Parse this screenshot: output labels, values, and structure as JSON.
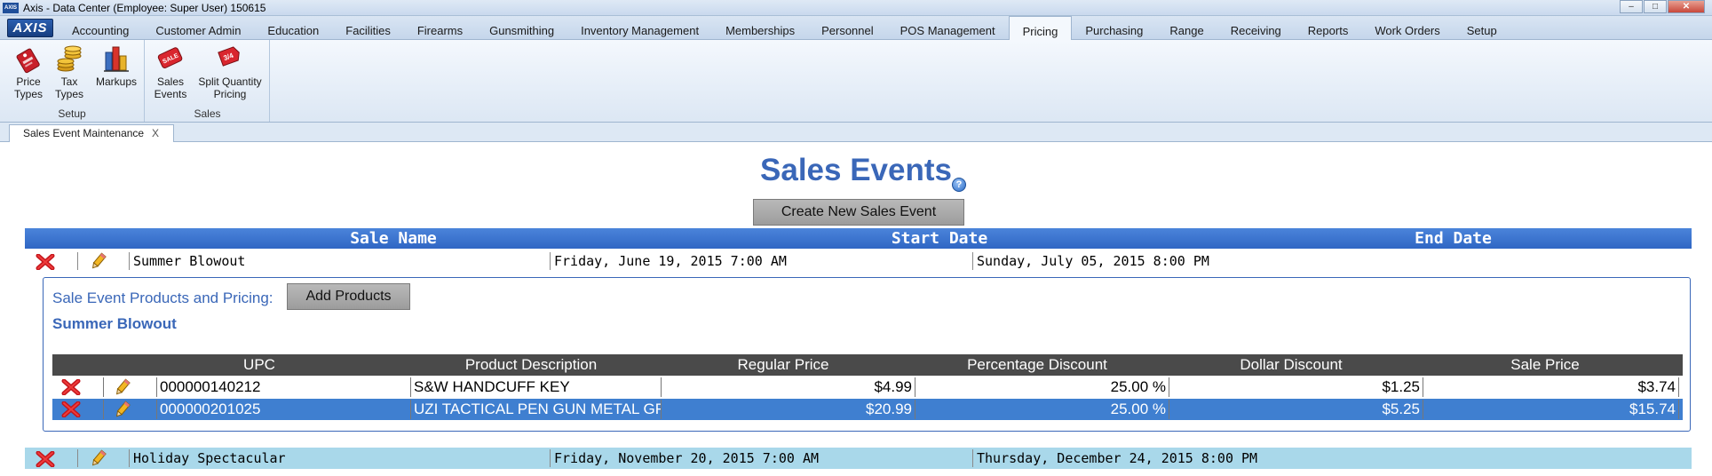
{
  "window": {
    "app_icon_text": "AXIS",
    "title": "Axis - Data Center  (Employee: Super User) 150615",
    "minimize": "–",
    "maximize": "□",
    "close": "✕"
  },
  "menu": {
    "logo": "AXIS",
    "tabs": [
      "Accounting",
      "Customer Admin",
      "Education",
      "Facilities",
      "Firearms",
      "Gunsmithing",
      "Inventory Management",
      "Memberships",
      "Personnel",
      "POS Management",
      "Pricing",
      "Purchasing",
      "Range",
      "Receiving",
      "Reports",
      "Work Orders",
      "Setup"
    ],
    "active_tab": "Pricing"
  },
  "ribbon": {
    "groups": [
      {
        "label": "Setup",
        "buttons": [
          {
            "label": "Price\nTypes",
            "icon": "price-tag-icon"
          },
          {
            "label": "Tax\nTypes",
            "icon": "coins-icon"
          },
          {
            "label": "Markups",
            "icon": "bar-chart-icon"
          }
        ]
      },
      {
        "label": "Sales",
        "buttons": [
          {
            "label": "Sales\nEvents",
            "icon": "sale-tag-icon"
          },
          {
            "label": "Split Quantity\nPricing",
            "icon": "split-price-tag-icon"
          }
        ]
      }
    ]
  },
  "doc_tab": {
    "label": "Sales Event Maintenance",
    "close": "X"
  },
  "main": {
    "title": "Sales Events",
    "help": "?",
    "create_button": "Create New Sales Event",
    "columns": [
      "Sale Name",
      "Start Date",
      "End Date"
    ],
    "events": [
      {
        "name": "Summer Blowout",
        "start": "Friday, June 19, 2015 7:00 AM",
        "end": "Sunday, July 05, 2015 8:00 PM"
      },
      {
        "name": "Holiday Spectacular",
        "start": "Friday, November 20, 2015 7:00 AM",
        "end": "Thursday, December 24, 2015 8:00 PM"
      }
    ]
  },
  "products_panel": {
    "label": "Sale Event Products and Pricing:",
    "add_button": "Add Products",
    "event_name": "Summer Blowout",
    "columns": [
      "UPC",
      "Product Description",
      "Regular Price",
      "Percentage Discount",
      "Dollar Discount",
      "Sale Price"
    ],
    "rows": [
      {
        "upc": "000000140212",
        "description": "S&W HANDCUFF KEY",
        "regular": "$4.99",
        "pct": "25.00 %",
        "dollar": "$1.25",
        "sale": "$3.74",
        "selected": false
      },
      {
        "upc": "000000201025",
        "description": "UZI TACTICAL PEN GUN METAL GR",
        "regular": "$20.99",
        "pct": "25.00 %",
        "dollar": "$5.25",
        "sale": "$15.74",
        "selected": true
      }
    ]
  },
  "colors": {
    "accent_blue": "#3a67b8",
    "header_blue": "#2f66c4",
    "selected_row": "#3f7fd0",
    "alt_row": "#a9d8ea",
    "table_head_dark": "#4a4a4a"
  }
}
